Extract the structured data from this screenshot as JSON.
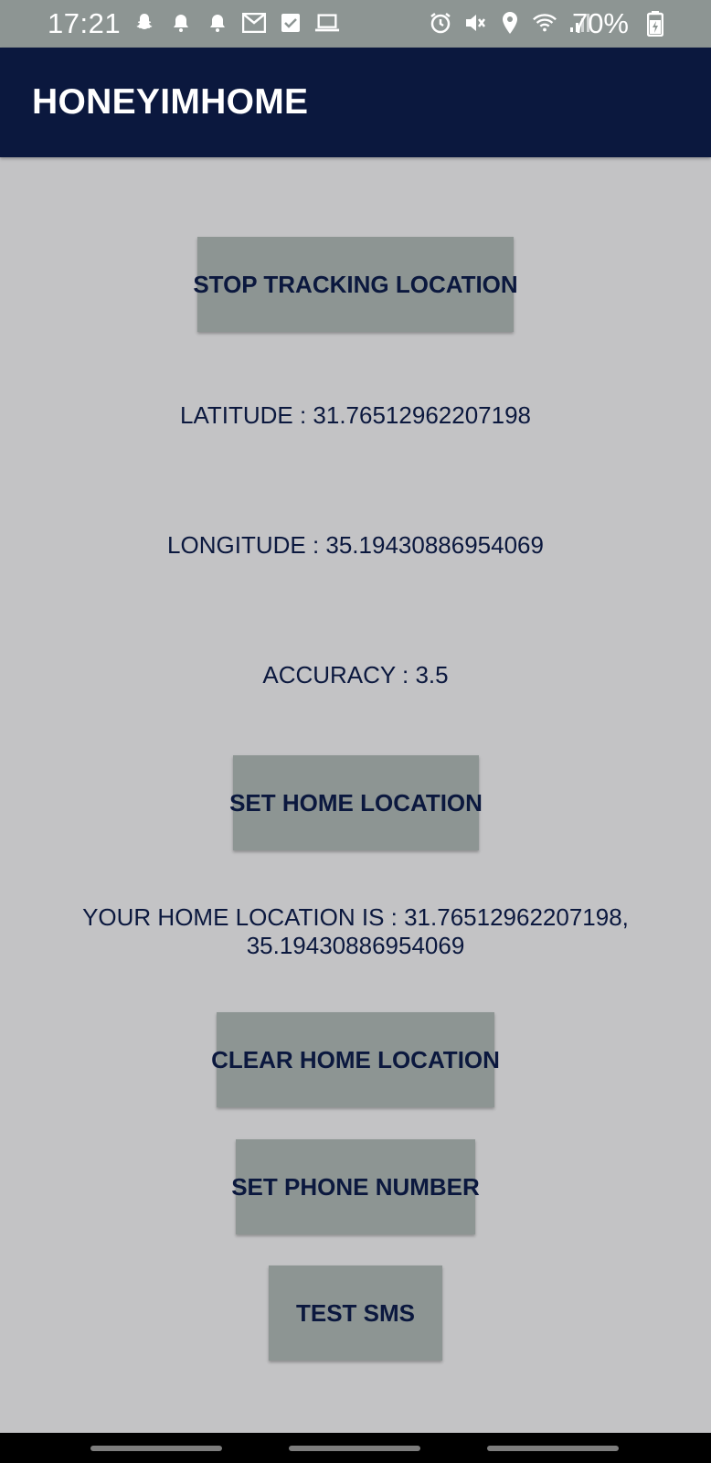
{
  "status_bar": {
    "time": "17:21",
    "battery_percent": "70%",
    "left_icons": [
      "snapchat-icon",
      "alarm-bell-icon",
      "alarm-bell-icon",
      "gmail-icon",
      "checkbox-icon",
      "laptop-icon"
    ],
    "right_icons": [
      "alarm-clock-icon",
      "mute-icon",
      "location-pin-icon",
      "wifi-icon",
      "signal-icon",
      "battery-charging-icon"
    ]
  },
  "app_bar": {
    "title": "HONEYIMHOME"
  },
  "buttons": {
    "stop_tracking": "STOP TRACKING LOCATION",
    "set_home": "SET HOME LOCATION",
    "clear_home": "CLEAR HOME LOCATION",
    "set_phone": "SET PHONE NUMBER",
    "test_sms": "TEST SMS"
  },
  "location": {
    "latitude_text": "LATITUDE : 31.76512962207198",
    "longitude_text": "LONGITUDE : 35.19430886954069",
    "accuracy_text": "ACCURACY : 3.5",
    "home_line1": "YOUR HOME LOCATION IS : 31.76512962207198,",
    "home_line2": "35.19430886954069"
  },
  "colors": {
    "app_bar_bg": "#0b183e",
    "status_bar_bg": "#8d9593",
    "page_bg": "#c3c3c5",
    "button_bg": "#8d9593",
    "text": "#0b183e"
  }
}
